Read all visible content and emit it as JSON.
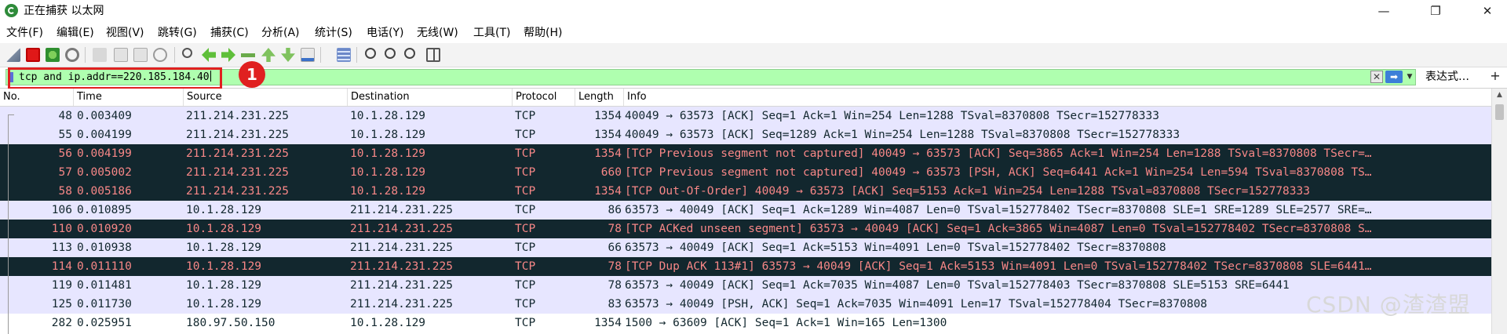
{
  "window": {
    "title": "正在捕获 以太网",
    "minimize": "—",
    "restore": "❐",
    "close": "✕"
  },
  "menu": [
    "文件(F)",
    "编辑(E)",
    "视图(V)",
    "跳转(G)",
    "捕获(C)",
    "分析(A)",
    "统计(S)",
    "电话(Y)",
    "无线(W)",
    "工具(T)",
    "帮助(H)"
  ],
  "filter": {
    "value": "tcp and ip.addr==220.185.184.40",
    "expression_label": "表达式…",
    "plus_label": "+"
  },
  "callout": {
    "number": "1"
  },
  "columns": [
    "No.",
    "Time",
    "Source",
    "Destination",
    "Protocol",
    "Length",
    "Info"
  ],
  "colors": {
    "normal_bg": "#ffffff",
    "alt_bg": "#e7e6ff",
    "bad_bg": "#12272e",
    "bad_fg": "#f78787",
    "filter_bg": "#afffaf",
    "highlight": "#e02020"
  },
  "packets": [
    {
      "no": "48",
      "time": "0.003409",
      "src": "211.214.231.225",
      "dst": "10.1.28.129",
      "proto": "TCP",
      "len": "1354",
      "info": "40049 → 63573 [ACK] Seq=1 Ack=1 Win=254 Len=1288 TSval=8370808 TSecr=152778333",
      "style": "alt"
    },
    {
      "no": "55",
      "time": "0.004199",
      "src": "211.214.231.225",
      "dst": "10.1.28.129",
      "proto": "TCP",
      "len": "1354",
      "info": "40049 → 63573 [ACK] Seq=1289 Ack=1 Win=254 Len=1288 TSval=8370808 TSecr=152778333",
      "style": "alt"
    },
    {
      "no": "56",
      "time": "0.004199",
      "src": "211.214.231.225",
      "dst": "10.1.28.129",
      "proto": "TCP",
      "len": "1354",
      "info": "[TCP Previous segment not captured] 40049 → 63573 [ACK] Seq=3865 Ack=1 Win=254 Len=1288 TSval=8370808 TSecr=…",
      "style": "bad"
    },
    {
      "no": "57",
      "time": "0.005002",
      "src": "211.214.231.225",
      "dst": "10.1.28.129",
      "proto": "TCP",
      "len": "660",
      "info": "[TCP Previous segment not captured] 40049 → 63573 [PSH, ACK] Seq=6441 Ack=1 Win=254 Len=594 TSval=8370808 TS…",
      "style": "bad"
    },
    {
      "no": "58",
      "time": "0.005186",
      "src": "211.214.231.225",
      "dst": "10.1.28.129",
      "proto": "TCP",
      "len": "1354",
      "info": "[TCP Out-Of-Order] 40049 → 63573 [ACK] Seq=5153 Ack=1 Win=254 Len=1288 TSval=8370808 TSecr=152778333",
      "style": "bad"
    },
    {
      "no": "106",
      "time": "0.010895",
      "src": "10.1.28.129",
      "dst": "211.214.231.225",
      "proto": "TCP",
      "len": "86",
      "info": "63573 → 40049 [ACK] Seq=1 Ack=1289 Win=4087 Len=0 TSval=152778402 TSecr=8370808 SLE=1 SRE=1289 SLE=2577 SRE=…",
      "style": "alt"
    },
    {
      "no": "110",
      "time": "0.010920",
      "src": "10.1.28.129",
      "dst": "211.214.231.225",
      "proto": "TCP",
      "len": "78",
      "info": "[TCP ACKed unseen segment] 63573 → 40049 [ACK] Seq=1 Ack=3865 Win=4087 Len=0 TSval=152778402 TSecr=8370808 S…",
      "style": "bad"
    },
    {
      "no": "113",
      "time": "0.010938",
      "src": "10.1.28.129",
      "dst": "211.214.231.225",
      "proto": "TCP",
      "len": "66",
      "info": "63573 → 40049 [ACK] Seq=1 Ack=5153 Win=4091 Len=0 TSval=152778402 TSecr=8370808",
      "style": "alt"
    },
    {
      "no": "114",
      "time": "0.011110",
      "src": "10.1.28.129",
      "dst": "211.214.231.225",
      "proto": "TCP",
      "len": "78",
      "info": "[TCP Dup ACK 113#1] 63573 → 40049 [ACK] Seq=1 Ack=5153 Win=4091 Len=0 TSval=152778402 TSecr=8370808 SLE=6441…",
      "style": "bad"
    },
    {
      "no": "119",
      "time": "0.011481",
      "src": "10.1.28.129",
      "dst": "211.214.231.225",
      "proto": "TCP",
      "len": "78",
      "info": "63573 → 40049 [ACK] Seq=1 Ack=7035 Win=4087 Len=0 TSval=152778403 TSecr=8370808 SLE=5153 SRE=6441",
      "style": "alt"
    },
    {
      "no": "125",
      "time": "0.011730",
      "src": "10.1.28.129",
      "dst": "211.214.231.225",
      "proto": "TCP",
      "len": "83",
      "info": "63573 → 40049 [PSH, ACK] Seq=1 Ack=7035 Win=4091 Len=17 TSval=152778404 TSecr=8370808",
      "style": "alt"
    },
    {
      "no": "282",
      "time": "0.025951",
      "src": "180.97.50.150",
      "dst": "10.1.28.129",
      "proto": "TCP",
      "len": "1354",
      "info": "1500 → 63609 [ACK] Seq=1 Ack=1 Win=165 Len=1300",
      "style": "normal"
    }
  ],
  "watermark": "CSDN @渣渣盟",
  "toolbar_icons": [
    "shark-fin-icon",
    "stop-icon",
    "restart-icon",
    "options-icon",
    "open-file-icon",
    "save-file-icon",
    "close-file-icon",
    "reload-icon",
    "find-icon",
    "back-icon",
    "forward-icon",
    "go-to-packet-icon",
    "first-packet-icon",
    "last-packet-icon",
    "autoscroll-icon",
    "colorize-icon",
    "zoom-in-icon",
    "zoom-out-icon",
    "zoom-reset-icon",
    "resize-columns-icon"
  ]
}
